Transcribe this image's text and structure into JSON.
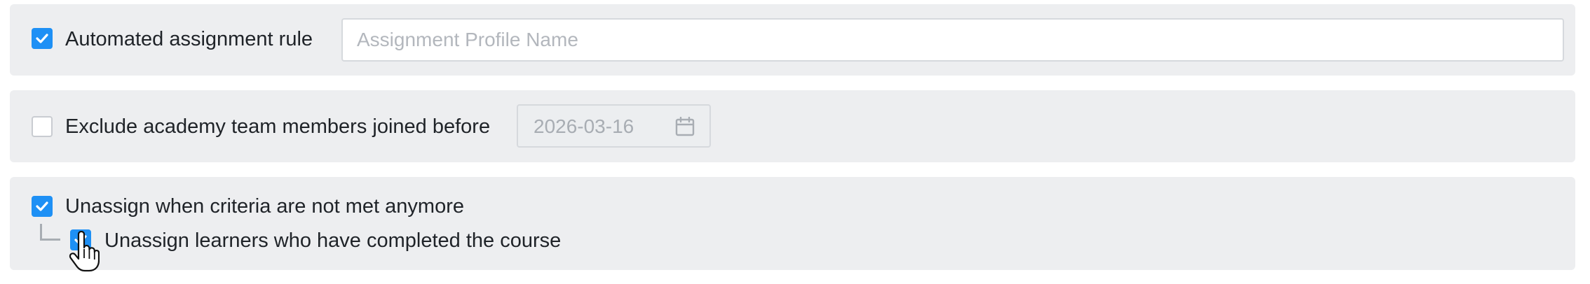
{
  "automated_assignment": {
    "checked": true,
    "label": "Automated assignment rule",
    "profile_name_value": "",
    "profile_name_placeholder": "Assignment Profile Name"
  },
  "exclude_members": {
    "checked": false,
    "label": "Exclude academy team members joined before",
    "date_value": "2026-03-16",
    "date_icon": "calendar-icon"
  },
  "unassign": {
    "checked": true,
    "label": "Unassign when criteria are not met anymore",
    "sub_option": {
      "checked": true,
      "label": "Unassign learners who have completed the course"
    }
  },
  "colors": {
    "accent": "#1e90f5",
    "panel_background": "#edeef0",
    "text": "#1f2328",
    "placeholder": "#b3b7bd"
  },
  "cursor": "hand-pointer-icon"
}
